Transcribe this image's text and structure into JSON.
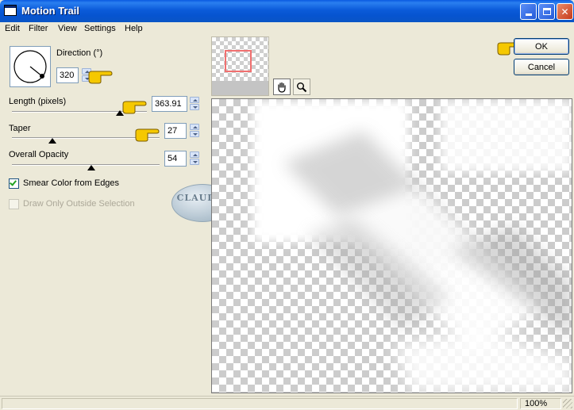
{
  "window": {
    "title": "Motion Trail"
  },
  "menu": [
    {
      "label": "Edit"
    },
    {
      "label": "Filter"
    },
    {
      "label": "View"
    },
    {
      "label": "Settings"
    },
    {
      "label": "Help"
    }
  ],
  "direction": {
    "label": "Direction (°)",
    "value": "320"
  },
  "length": {
    "label": "Length (pixels)",
    "value": "363.91"
  },
  "taper": {
    "label": "Taper",
    "value": "27"
  },
  "opacity": {
    "label": "Overall Opacity",
    "value": "54"
  },
  "smear": {
    "label": "Smear Color from Edges",
    "checked": true
  },
  "outside": {
    "label": "Draw Only Outside Selection",
    "checked": false,
    "enabled": false
  },
  "watermark": {
    "text": "CLAUDIA"
  },
  "buttons": {
    "ok": "OK",
    "cancel": "Cancel"
  },
  "status": {
    "zoom": "100%"
  },
  "colors": {
    "titlebar": "#0a5ae0",
    "dialog": "#ece9d8",
    "button_border": "#003c74",
    "viewport": "#f07070",
    "hand": "#f5c800"
  }
}
